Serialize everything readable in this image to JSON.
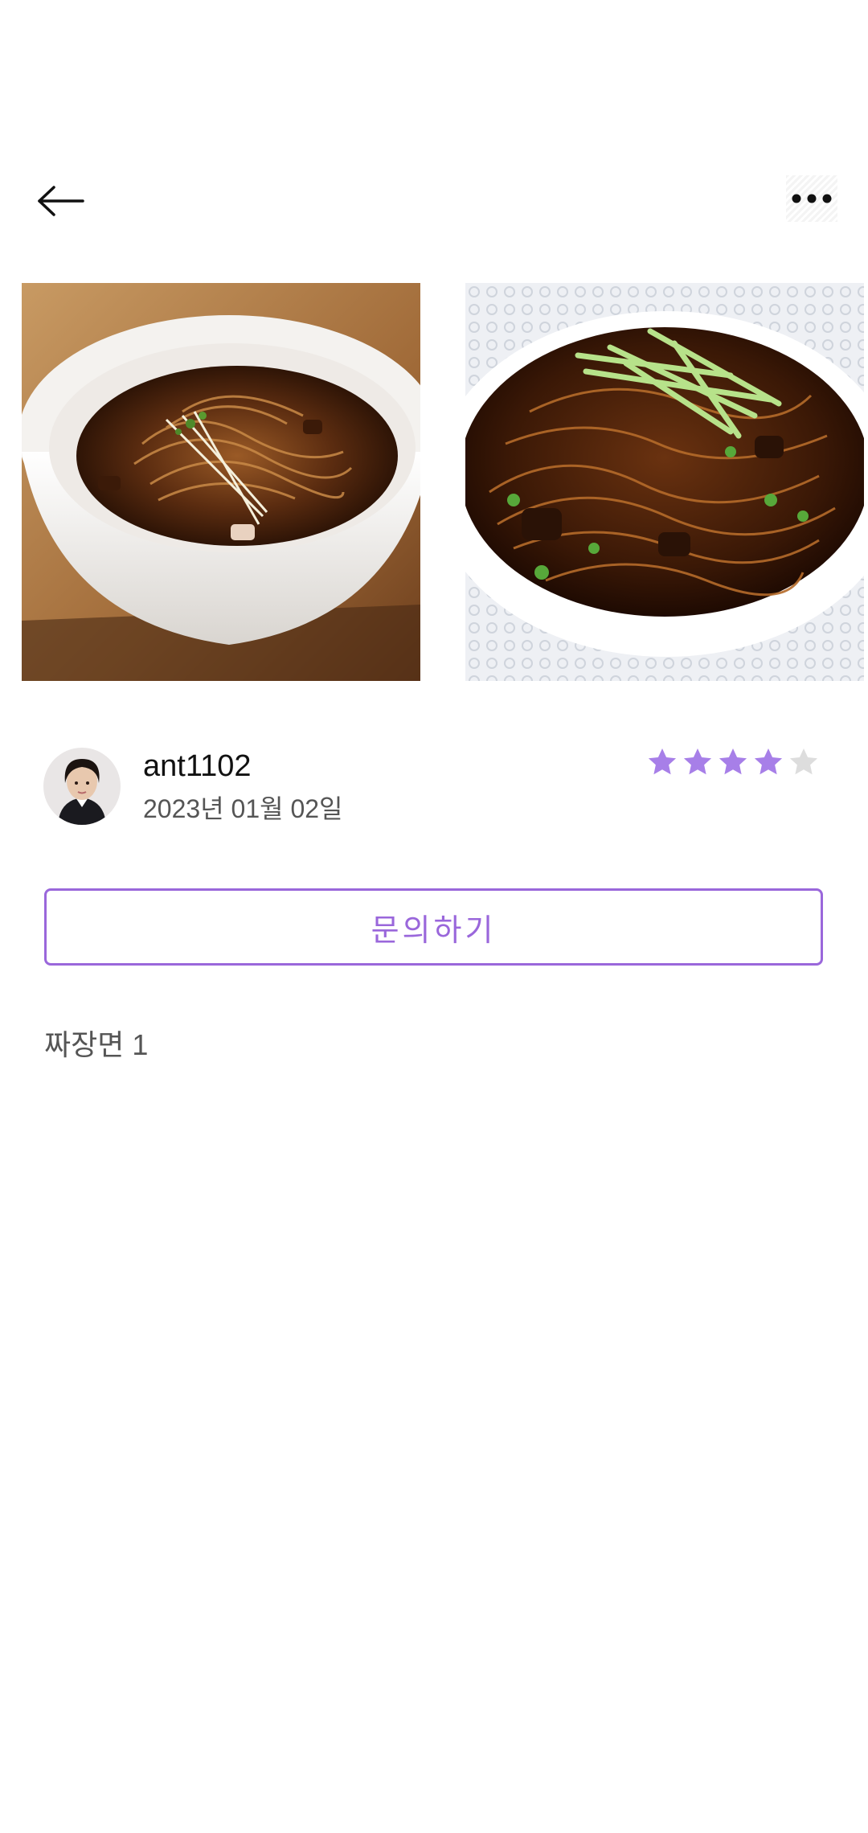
{
  "header": {
    "back_icon": "arrow-left-icon",
    "more_icon": "more-horizontal-icon"
  },
  "photos": [
    {
      "name": "jjajangmyeon-bowl-photo"
    },
    {
      "name": "jjajangmyeon-plate-photo"
    }
  ],
  "review": {
    "username": "ant1102",
    "date": "2023년 01월 02일",
    "rating": 4,
    "max_rating": 5,
    "content": "짜장면 1"
  },
  "actions": {
    "inquiry_label": "문의하기"
  },
  "colors": {
    "accent": "#9a67db",
    "star_filled": "#a77fe8",
    "star_empty": "#dddddd"
  }
}
